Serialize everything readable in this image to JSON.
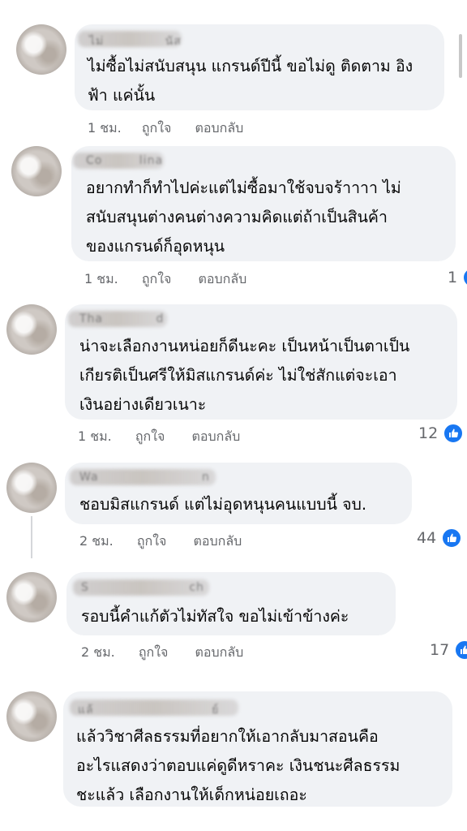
{
  "comments": [
    {
      "id": "c1",
      "name": "ไม่ ",
      "name_tail": "นัส",
      "text": "ไม่ซื้อไม่สนับสนุน แกรนด์ปีนี้ ขอไม่ดู ติดตาม อิง\nฟ้า แค่นั้น",
      "time": "1 ชม.",
      "like_label": "ถูกใจ",
      "reply_label": "ตอบกลับ",
      "reactions": ""
    },
    {
      "id": "c2",
      "name": "Co ",
      "name_tail": "lina",
      "text": "อยากทำก็ทำไปค่ะแต่ไม่ซื้อมาใช้จบจร้าาาา ไม่\nสนับสนุนต่างคนต่างความคิดแต่ถ้าเป็นสินค้า\nของแกรนด์ก็อุดหนุน",
      "time": "1 ชม.",
      "like_label": "ถูกใจ",
      "reply_label": "ตอบกลับ",
      "reactions": "1"
    },
    {
      "id": "c3",
      "name": "Tha ",
      "name_tail": "d",
      "text": "น่าจะเลือกงานหน่อยก็ดีนะคะ เป็นหน้าเป็นตาเป็น\nเกียรติเป็นศรีให้มิสแกรนด์ค่ะ ไม่ใช่สักแต่จะเอา\nเงินอย่างเดียวเนาะ",
      "time": "1 ชม.",
      "like_label": "ถูกใจ",
      "reply_label": "ตอบกลับ",
      "reactions": "12"
    },
    {
      "id": "c4",
      "name": "Wa ",
      "name_tail": "n",
      "text": "ชอบมิสแกรนด์ แต่ไม่อุดหนุนคนแบบนี้ จบ.",
      "time": "2 ชม.",
      "like_label": "ถูกใจ",
      "reply_label": "ตอบกลับ",
      "reactions": "44"
    },
    {
      "id": "c5",
      "name": "S ",
      "name_tail": "ch",
      "text": "รอบนี้คำแก้ตัวไม่ทัสใจ ขอไม่เข้าข้างค่ะ",
      "time": "2 ชม.",
      "like_label": "ถูกใจ",
      "reply_label": "ตอบกลับ",
      "reactions": "17"
    },
    {
      "id": "c6",
      "name": "แล้ ",
      "name_tail": "ย์",
      "text": "แล้ววิชาศีลธรรมที่อยากให้เอากลับมาสอนคือ\nอะไรแสดงว่าตอบแค่ดูดีหราคะ เงินชนะศีลธรรม\nชะแล้ว เลือกงานให้เด็กหน่อยเถอะ",
      "time": "",
      "like_label": "",
      "reply_label": "",
      "reactions": ""
    }
  ],
  "colors": {
    "bubble": "#f0f2f5",
    "meta_text": "#65676b",
    "like_blue": "#1877f2"
  },
  "icons": {
    "like": "thumbs-up-icon"
  }
}
